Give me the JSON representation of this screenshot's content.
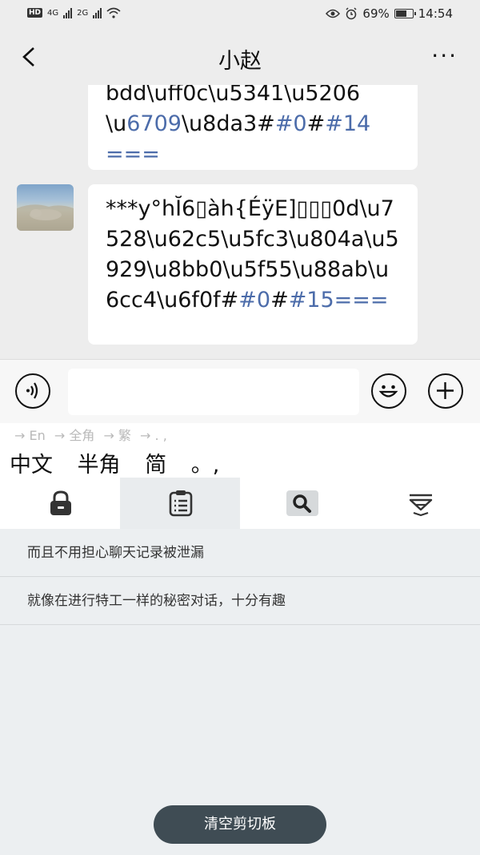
{
  "status": {
    "hd_label": "HD",
    "net1": "4G",
    "net2": "2G",
    "battery_percent_text": "69%",
    "battery_level": 0.69,
    "time": "14:54"
  },
  "header": {
    "title": "小赵",
    "more_label": "···"
  },
  "messages": [
    {
      "text_line1": "bdd\\uff0c\\u5341\\u5206",
      "text_line2_a": "\\u",
      "text_line2_b": "6709",
      "text_line2_c": "\\u8da3#",
      "text_line2_d": "#0",
      "text_line2_e": "#",
      "text_line2_f": "#14",
      "text_line3": "==="
    },
    {
      "text_part1": "***y°hĬ6\u0000àh{ÉÿE]\u0000\u0000\u00000d\\u7528\\u62c5\\u5fc3\\u804a\\u5929\\u8bb0\\u5f55\\u88ab\\u6cc4\\u6f0f#",
      "text_part2": "#0",
      "text_part3": "#",
      "text_part4": "#15===",
      "display_part1": "***y°hĬ6▯àh{ÉÿE]▯▯▯0d\\u7528\\u62c5\\u5fc3\\u804a\\u5929\\u8bb0\\u5f55\\u88ab\\u6cc4\\u6f0f#"
    }
  ],
  "ime": {
    "hints": [
      "→ En",
      "→ 全角",
      "→ 繁",
      "→ . ,"
    ],
    "candidates": [
      "中文",
      "半角",
      "简",
      "。,"
    ]
  },
  "toolbar": {
    "icons": [
      "lock-icon",
      "clipboard-icon",
      "search-icon",
      "collapse-icon"
    ],
    "active_index": 1
  },
  "clipboard_items": [
    "而且不用担心聊天记录被泄漏",
    "就像在进行特工一样的秘密对话，十分有趣"
  ],
  "clear_button_label": "清空剪切板"
}
